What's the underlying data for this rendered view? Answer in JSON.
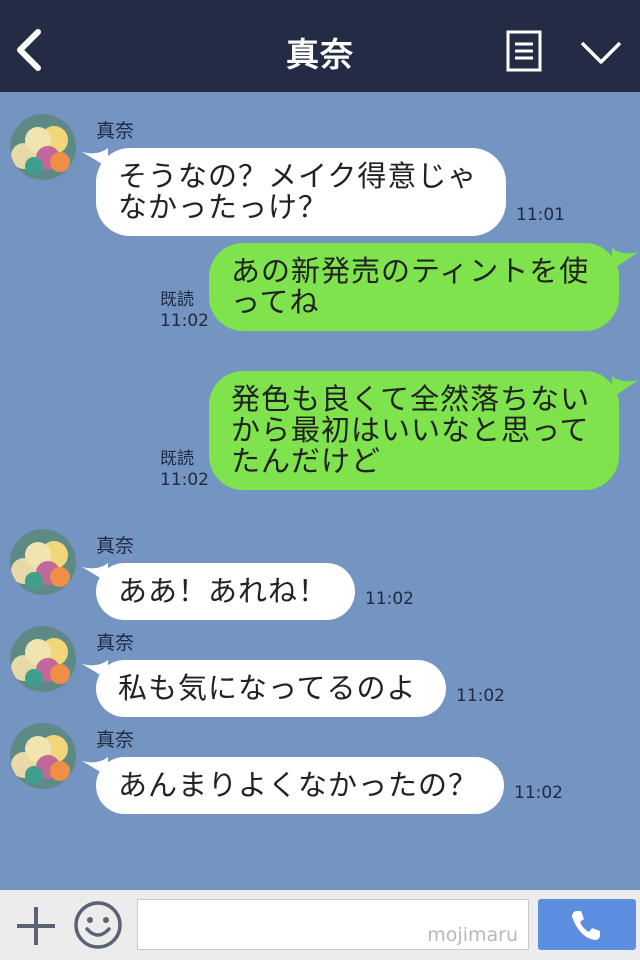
{
  "header": {
    "title": "真奈"
  },
  "messages": [
    {
      "sender": "真奈",
      "text": "そうなの？メイク得意じゃ\nなかったっけ？",
      "time": "11:01"
    },
    {
      "read": "既読",
      "time": "11:02",
      "text": "あの新発売のティントを使\nってね"
    },
    {
      "read": "既読",
      "time": "11:02",
      "text": "発色も良くて全然落ちない\nから最初はいいなと思って\nたんだけど"
    },
    {
      "sender": "真奈",
      "text": "ああ！あれね！",
      "time": "11:02"
    },
    {
      "sender": "真奈",
      "text": "私も気になってるのよ",
      "time": "11:02"
    },
    {
      "sender": "真奈",
      "text": "あんまりよくなかったの？",
      "time": "11:02"
    }
  ],
  "footer": {
    "input_value": "",
    "watermark": "mojimaru"
  },
  "colors": {
    "header": "#232c44",
    "background": "#7494c2",
    "outgoing": "#7ee34d",
    "incoming": "#ffffff",
    "call": "#5c8ee0"
  }
}
